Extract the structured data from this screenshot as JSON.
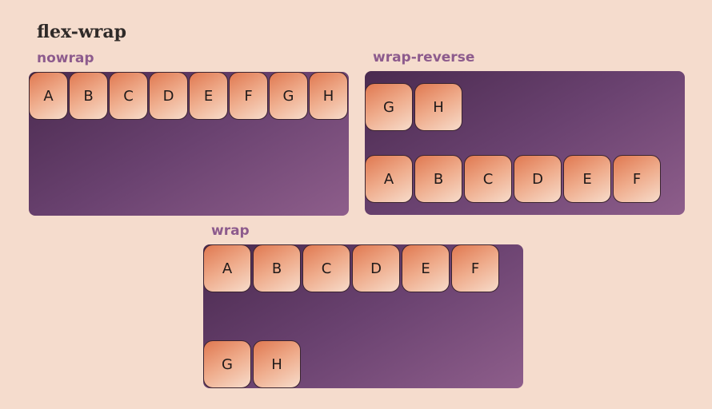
{
  "page": {
    "title": "flex-wrap"
  },
  "demos": {
    "nowrap": {
      "label": "nowrap",
      "items": [
        "A",
        "B",
        "C",
        "D",
        "E",
        "F",
        "G",
        "H"
      ]
    },
    "wrap_reverse": {
      "label": "wrap-reverse",
      "items": [
        "A",
        "B",
        "C",
        "D",
        "E",
        "F",
        "G",
        "H"
      ]
    },
    "wrap": {
      "label": "wrap",
      "items": [
        "A",
        "B",
        "C",
        "D",
        "E",
        "F",
        "G",
        "H"
      ]
    }
  },
  "colors": {
    "background": "#f5dccd",
    "label": "#8d5b8d",
    "container_dark": "#4a2a4f",
    "container_light": "#8e5e8b",
    "box_dark": "#e07850",
    "box_light": "#f7dccb"
  }
}
